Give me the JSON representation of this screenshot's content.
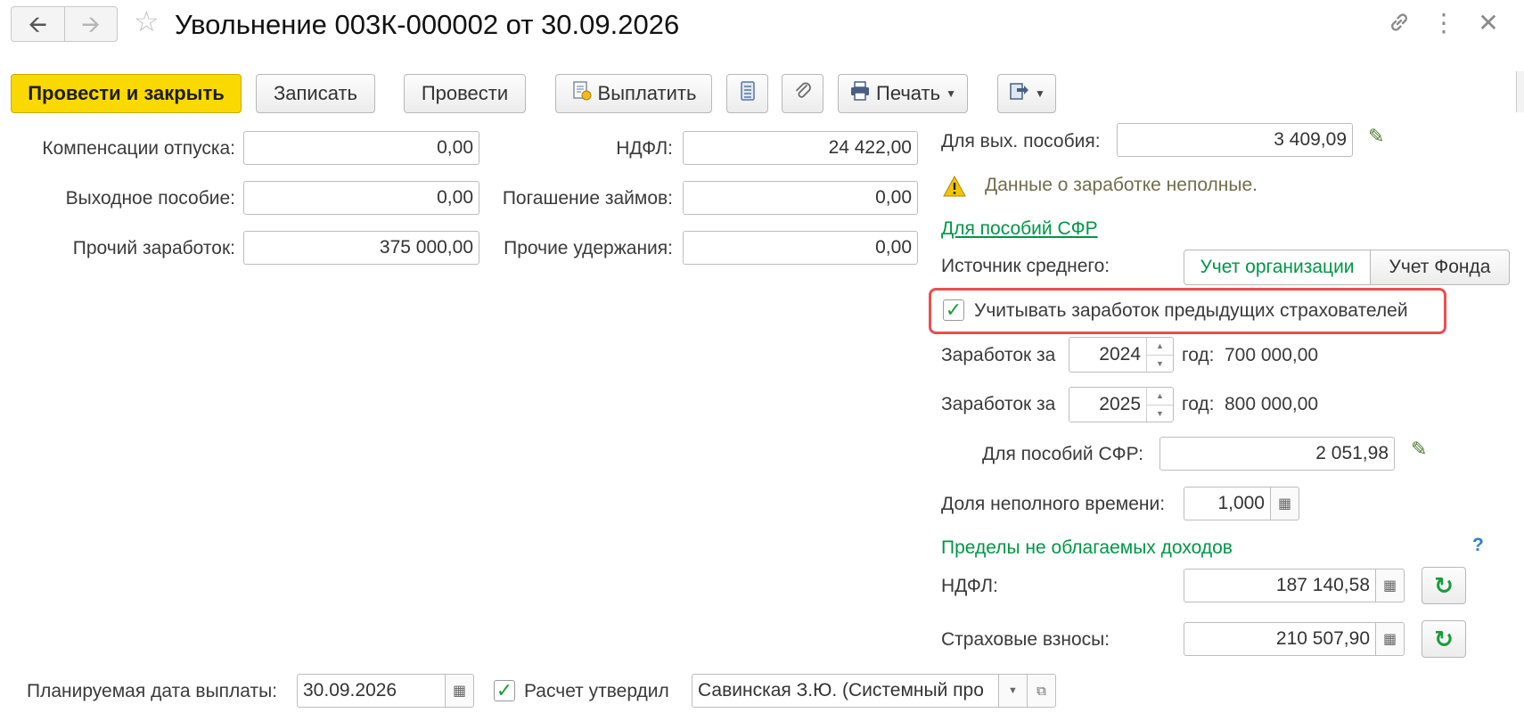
{
  "window": {
    "title": "Увольнение 003К-000002 от 30.09.2026"
  },
  "toolbar": {
    "post_close": "Провести и закрыть",
    "save": "Записать",
    "post": "Провести",
    "pay": "Выплатить",
    "print": "Печать"
  },
  "left": {
    "vacation_comp_label": "Компенсации отпуска:",
    "vacation_comp_value": "0,00",
    "severance_label": "Выходное пособие:",
    "severance_value": "0,00",
    "other_earnings_label": "Прочий заработок:",
    "other_earnings_value": "375 000,00"
  },
  "middle": {
    "ndfl_label": "НДФЛ:",
    "ndfl_value": "24 422,00",
    "loans_label": "Погашение займов:",
    "loans_value": "0,00",
    "other_deductions_label": "Прочие удержания:",
    "other_deductions_value": "0,00"
  },
  "right": {
    "severance_avg_label": "Для вых. пособия:",
    "severance_avg_value": "3 409,09",
    "warning_text": "Данные о заработке неполные.",
    "sfr_link": "Для пособий СФР",
    "source_label": "Источник среднего:",
    "source_org": "Учет организации",
    "source_fund": "Учет Фонда",
    "prev_insurers_label": "Учитывать заработок предыдущих страхователей",
    "earn1_label": "Заработок за",
    "earn1_year": "2024",
    "earn1_suffix": "год:",
    "earn1_amount": "700 000,00",
    "earn2_label": "Заработок за",
    "earn2_year": "2025",
    "earn2_suffix": "год:",
    "earn2_amount": "800 000,00",
    "sfr_avg_label": "Для пособий СФР:",
    "sfr_avg_value": "2 051,98",
    "parttime_label": "Доля неполного времени:",
    "parttime_value": "1,000",
    "limits_title": "Пределы не облагаемых доходов",
    "help": "?",
    "limit_ndfl_label": "НДФЛ:",
    "limit_ndfl_value": "187 140,58",
    "limit_ins_label": "Страховые взносы:",
    "limit_ins_value": "210 507,90"
  },
  "bottom": {
    "pay_date_label": "Планируемая дата выплаты:",
    "pay_date_value": "30.09.2026",
    "approved_label": "Расчет утвердил",
    "approved_by": "Савинская З.Ю. (Системный про"
  },
  "colors": {
    "primary_button": "#fad900",
    "green": "#009646",
    "highlight": "#e84f4f"
  }
}
